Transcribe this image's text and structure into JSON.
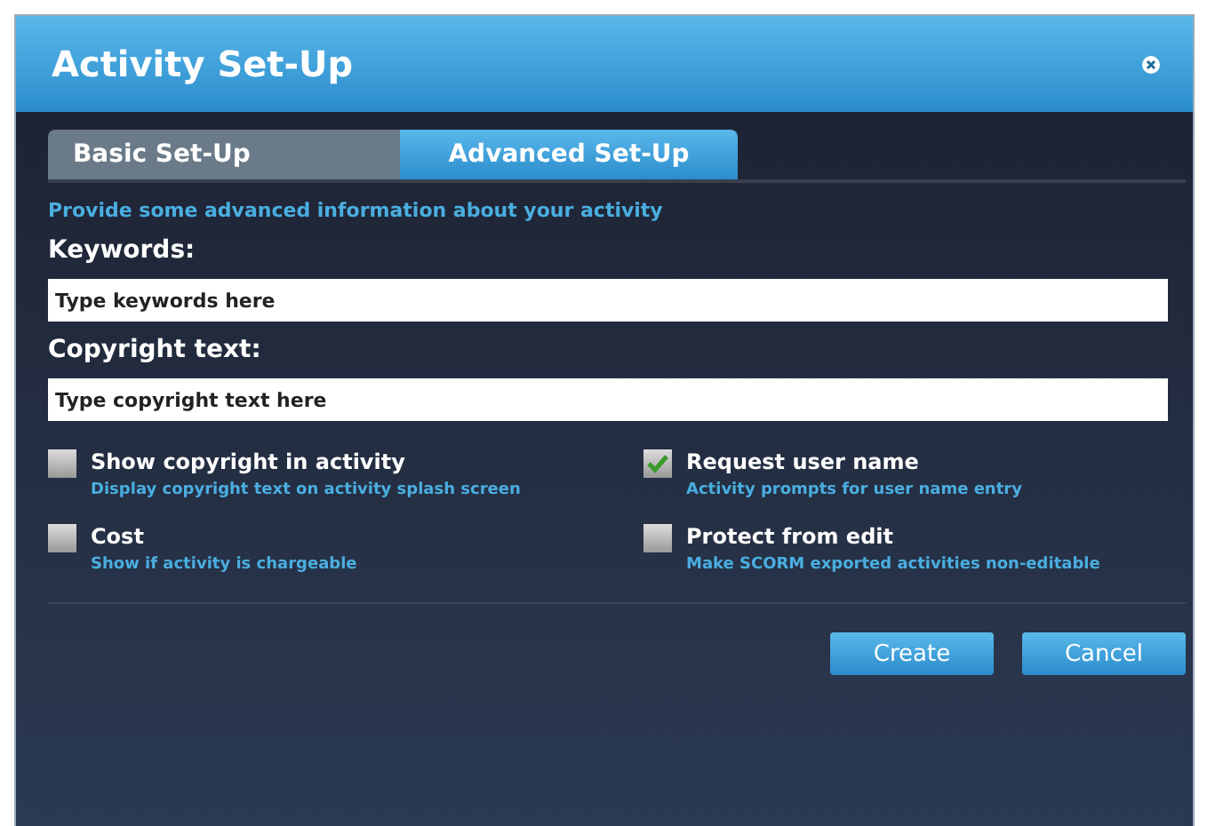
{
  "window": {
    "title": "Activity Set-Up"
  },
  "tabs": [
    {
      "label": "Basic Set-Up",
      "selected": false
    },
    {
      "label": "Advanced Set-Up",
      "selected": true
    }
  ],
  "intro": "Provide some advanced information about your activity",
  "fields": [
    {
      "label": "Keywords:",
      "placeholder": "Type keywords here"
    },
    {
      "label": "Copyright text:",
      "placeholder": "Type copyright text here"
    }
  ],
  "options": [
    {
      "label": "Show copyright in activity",
      "hint": "Display copyright text on activity splash screen",
      "checked": false
    },
    {
      "label": "Request user name",
      "hint": "Activity prompts for user name entry",
      "checked": true
    },
    {
      "label": "Cost",
      "hint": "Show if activity is chargeable",
      "checked": false
    },
    {
      "label": "Protect from edit",
      "hint": "Make SCORM exported activities non-editable",
      "checked": false
    }
  ],
  "buttons": [
    "Create",
    "Cancel"
  ]
}
